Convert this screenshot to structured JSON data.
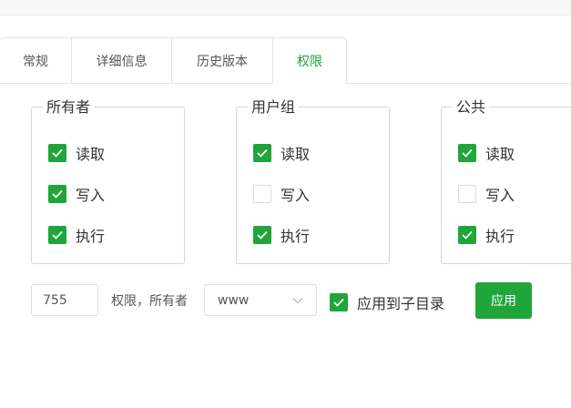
{
  "tabs": [
    {
      "label": "常规",
      "active": false
    },
    {
      "label": "详细信息",
      "active": false
    },
    {
      "label": "历史版本",
      "active": false
    },
    {
      "label": "权限",
      "active": true
    }
  ],
  "groups": [
    {
      "title": "所有者",
      "options": [
        {
          "label": "读取",
          "checked": true
        },
        {
          "label": "写入",
          "checked": true
        },
        {
          "label": "执行",
          "checked": true
        }
      ]
    },
    {
      "title": "用户组",
      "options": [
        {
          "label": "读取",
          "checked": true
        },
        {
          "label": "写入",
          "checked": false
        },
        {
          "label": "执行",
          "checked": true
        }
      ]
    },
    {
      "title": "公共",
      "options": [
        {
          "label": "读取",
          "checked": true
        },
        {
          "label": "写入",
          "checked": false
        },
        {
          "label": "执行",
          "checked": true
        }
      ]
    }
  ],
  "permission": {
    "value": "755",
    "owner_label": "权限，所有者",
    "owner_value": "www",
    "apply_subdir_label": "应用到子目录",
    "apply_subdir_checked": true,
    "apply_button": "应用"
  },
  "colors": {
    "accent": "#20a53a",
    "border": "#d6d6d6",
    "text": "#333333"
  },
  "icons": {
    "check": "check-icon",
    "dropdown": "chevron-down-icon"
  }
}
